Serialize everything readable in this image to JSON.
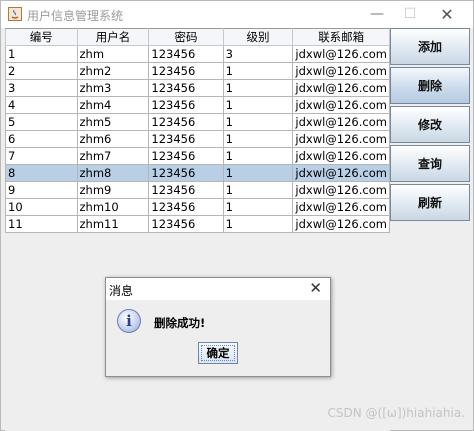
{
  "window": {
    "title": "用户信息管理系统",
    "minimize": "—",
    "maximize": "☐",
    "close": "✕"
  },
  "table": {
    "headers": [
      "编号",
      "用户名",
      "密码",
      "级别",
      "联系邮箱"
    ],
    "rows": [
      [
        "1",
        "zhm",
        "123456",
        "3",
        "jdxwl@126.com"
      ],
      [
        "2",
        "zhm2",
        "123456",
        "1",
        "jdxwl@126.com"
      ],
      [
        "3",
        "zhm3",
        "123456",
        "1",
        "jdxwl@126.com"
      ],
      [
        "4",
        "zhm4",
        "123456",
        "1",
        "jdxwl@126.com"
      ],
      [
        "5",
        "zhm5",
        "123456",
        "1",
        "jdxwl@126.com"
      ],
      [
        "6",
        "zhm6",
        "123456",
        "1",
        "jdxwl@126.com"
      ],
      [
        "7",
        "zhm7",
        "123456",
        "1",
        "jdxwl@126.com"
      ],
      [
        "8",
        "zhm8",
        "123456",
        "1",
        "jdxwl@126.com"
      ],
      [
        "9",
        "zhm9",
        "123456",
        "1",
        "jdxwl@126.com"
      ],
      [
        "10",
        "zhm10",
        "123456",
        "1",
        "jdxwl@126.com"
      ],
      [
        "11",
        "zhm11",
        "123456",
        "1",
        "jdxwl@126.com"
      ]
    ],
    "selected_row": 7
  },
  "buttons": {
    "add": "添加",
    "delete": "删除",
    "edit": "修改",
    "query": "查询",
    "refresh": "刷新"
  },
  "dialog": {
    "title": "消息",
    "close": "✕",
    "icon": "i",
    "message": "删除成功!",
    "ok": "确定"
  },
  "watermark": "CSDN @([ω])hiahiahia."
}
